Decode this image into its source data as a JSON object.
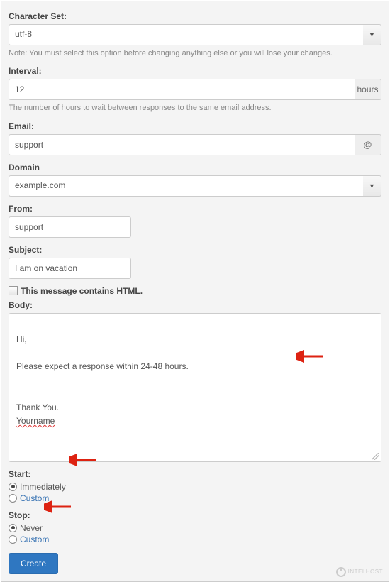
{
  "charset": {
    "label": "Character Set:",
    "value": "utf-8",
    "note": "Note: You must select this option before changing anything else or you will lose your changes."
  },
  "interval": {
    "label": "Interval:",
    "value": "12",
    "unit": "hours",
    "note": "The number of hours to wait between responses to the same email address."
  },
  "email": {
    "label": "Email:",
    "value": "support",
    "addon": "@"
  },
  "domain": {
    "label": "Domain",
    "value": "example.com"
  },
  "from": {
    "label": "From:",
    "value": "support"
  },
  "subject": {
    "label": "Subject:",
    "value": "I am on vacation"
  },
  "html_checkbox": {
    "label": "This message contains HTML.",
    "checked": false
  },
  "body": {
    "label": "Body:",
    "line1": "Hi,",
    "line2": "Please expect a response within 24-48 hours.",
    "line3": "Thank You.",
    "line4": "Yourname"
  },
  "start": {
    "label": "Start:",
    "options": [
      {
        "label": "Immediately",
        "checked": true
      },
      {
        "label": "Custom",
        "checked": false
      }
    ]
  },
  "stop": {
    "label": "Stop:",
    "options": [
      {
        "label": "Never",
        "checked": true
      },
      {
        "label": "Custom",
        "checked": false
      }
    ]
  },
  "create_button": "Create",
  "watermark": "INTELHOST"
}
